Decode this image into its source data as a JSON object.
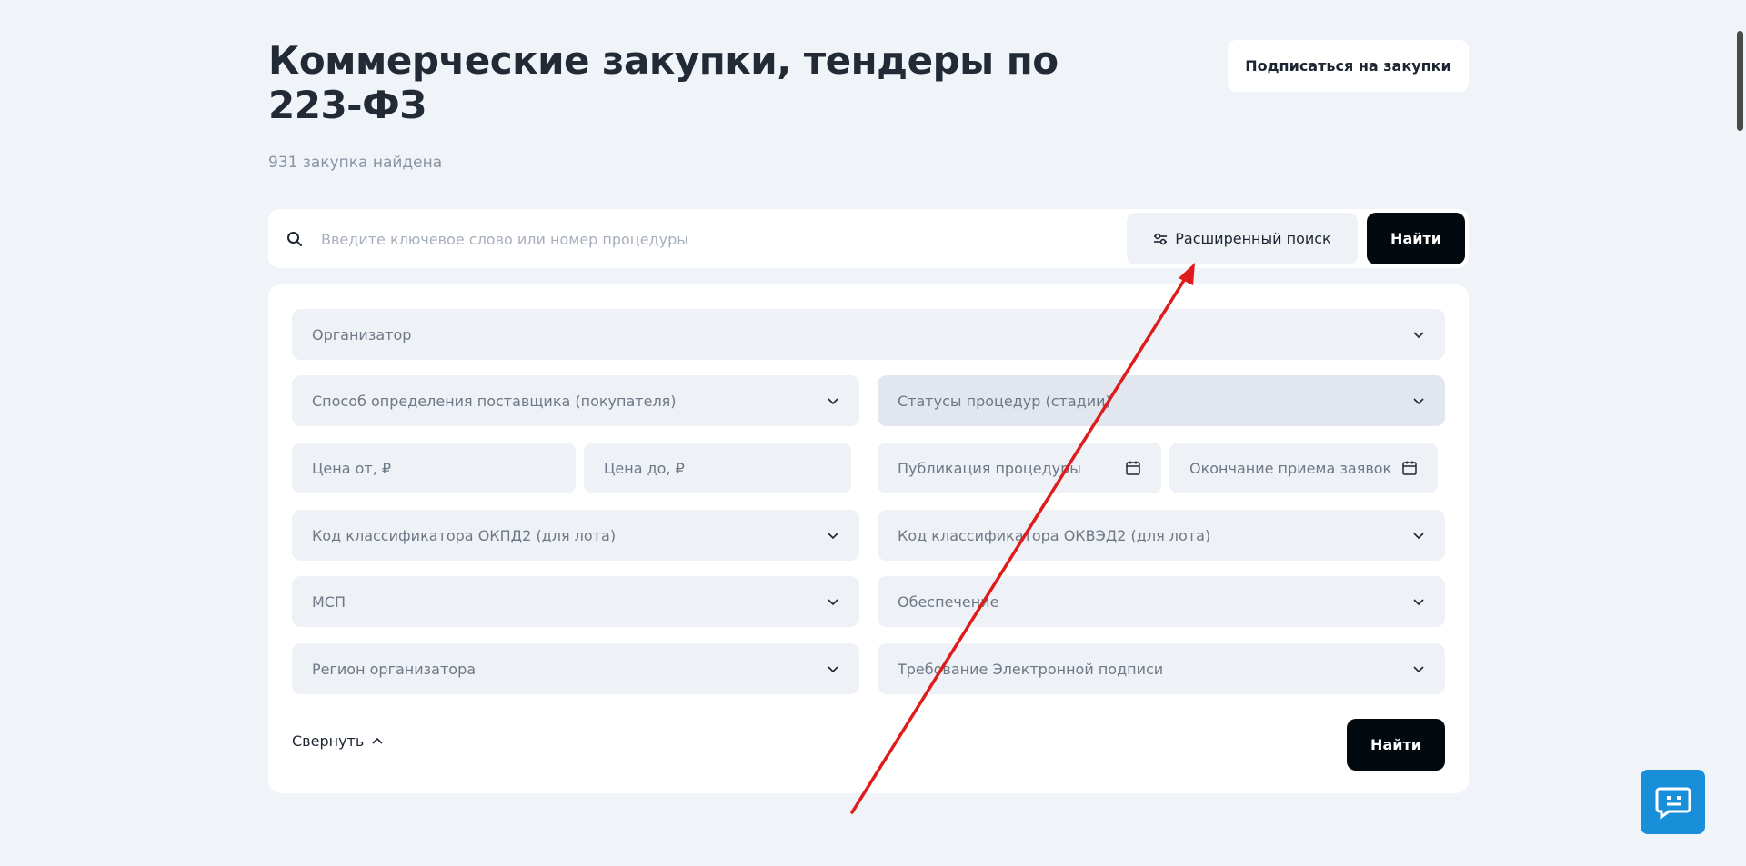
{
  "header": {
    "title": "Коммерческие закупки, тендеры по 223-ФЗ",
    "subscribe_label": "Подписаться на закупки",
    "count_text": "931 закупка найдена"
  },
  "search": {
    "placeholder": "Введите ключевое слово или номер процедуры",
    "value": "",
    "advanced_label": "Расширенный поиск",
    "find_label": "Найти"
  },
  "filters": {
    "organizer": "Организатор",
    "supplier_method": "Способ определения поставщика (покупателя)",
    "statuses": "Статусы процедур (стадии)",
    "price_from": "Цена от, ₽",
    "price_to": "Цена до, ₽",
    "publication": "Публикация процедуры",
    "deadline": "Окончание приема заявок",
    "okpd2": "Код классификатора ОКПД2 (для лота)",
    "okved2": "Код классификатора ОКВЭД2 (для лота)",
    "msp": "МСП",
    "security": "Обеспечение",
    "region": "Регион организатора",
    "signature": "Требование Электронной подписи"
  },
  "panel": {
    "collapse_label": "Свернуть",
    "find_label": "Найти"
  },
  "colors": {
    "background": "#f0f3f8",
    "field": "#eef1f6",
    "primary_button": "#02090f",
    "chat_button": "#1a8fd9",
    "annotation_arrow": "#e01b1b"
  }
}
